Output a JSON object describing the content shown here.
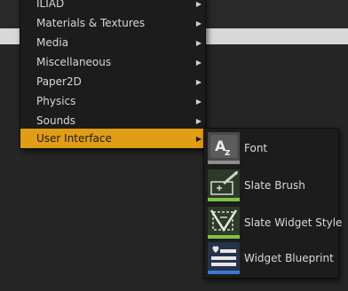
{
  "menu": {
    "items": [
      {
        "label": "ILIAD",
        "has_submenu": true
      },
      {
        "label": "Materials & Textures",
        "has_submenu": true
      },
      {
        "label": "Media",
        "has_submenu": true
      },
      {
        "label": "Miscellaneous",
        "has_submenu": true
      },
      {
        "label": "Paper2D",
        "has_submenu": true
      },
      {
        "label": "Physics",
        "has_submenu": true
      },
      {
        "label": "Sounds",
        "has_submenu": true
      },
      {
        "label": "User Interface",
        "has_submenu": true,
        "active": true
      }
    ],
    "chevron_glyph": "▶"
  },
  "submenu": {
    "items": [
      {
        "label": "Font",
        "icon": "font-icon",
        "bar_color": "#8f8f8f"
      },
      {
        "label": "Slate Brush",
        "icon": "slate-brush-icon",
        "bar_color": "#7ec24a"
      },
      {
        "label": "Slate Widget Style",
        "icon": "slate-widget-style-icon",
        "bar_color": "#7ec24a"
      },
      {
        "label": "Widget Blueprint",
        "icon": "widget-blueprint-icon",
        "bar_color": "#3b78d6"
      }
    ]
  },
  "colors": {
    "accent": "#e19d13",
    "menu_bg": "#1c1c1c",
    "text": "#d7d7d7"
  }
}
